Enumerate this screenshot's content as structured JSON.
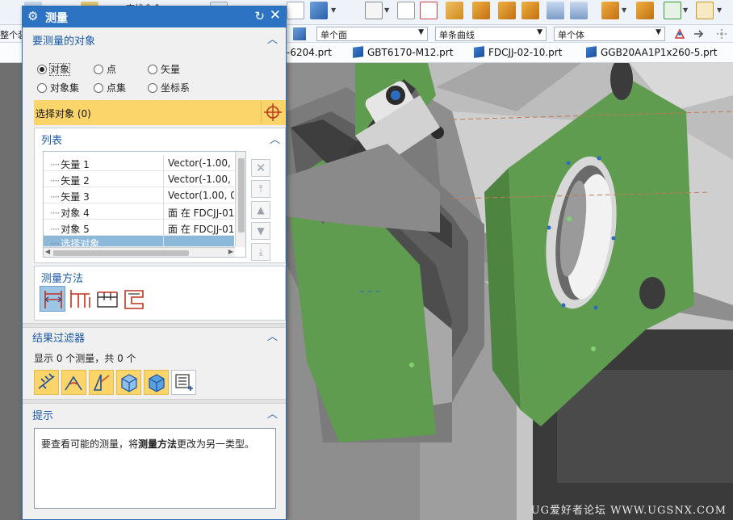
{
  "toolbar": {
    "left_labels": [
      "查找命令"
    ],
    "row2_left_label": "整个装"
  },
  "filterbar": {
    "face_filter": "单个面",
    "curve_filter": "单条曲线",
    "body_filter": "单个体"
  },
  "file_tabs": [
    {
      "label": "-6204.prt"
    },
    {
      "label": "GBT6170-M12.prt"
    },
    {
      "label": "FDCJJ-02-10.prt"
    },
    {
      "label": "GGB20AA1P1x260-5.prt"
    }
  ],
  "dialog": {
    "title": "测量",
    "section_objects": {
      "title": "要测量的对象",
      "radios": [
        {
          "label": "对象",
          "checked": true
        },
        {
          "label": "点",
          "checked": false
        },
        {
          "label": "矢量",
          "checked": false
        },
        {
          "label": "对象集",
          "checked": false
        },
        {
          "label": "点集",
          "checked": false
        },
        {
          "label": "坐标系",
          "checked": false
        }
      ],
      "select_label": "选择对象 (0)"
    },
    "list": {
      "title": "列表",
      "rows": [
        {
          "name": "矢量 1",
          "value": "Vector(-1.00, 0"
        },
        {
          "name": "矢量 2",
          "value": "Vector(-1.00, 0"
        },
        {
          "name": "矢量 3",
          "value": "Vector(1.00, 0"
        },
        {
          "name": "对象 4",
          "value": "面 在 FDCJJ-01"
        },
        {
          "name": "对象 5",
          "value": "面 在 FDCJJ-01"
        },
        {
          "name": "选择对象",
          "value": ""
        }
      ]
    },
    "method": {
      "title": "测量方法"
    },
    "result_filter": {
      "title": "结果过滤器",
      "count_text": "显示 0 个测量，共 0 个"
    },
    "hint": {
      "title": "提示",
      "text_before": "要查看可能的测量，将",
      "text_bold": "测量方法",
      "text_after": "更改为另一类型。"
    }
  },
  "watermark": "UG爱好者论坛 WWW.UGSNX.COM",
  "colors": {
    "title_bar": "#2d73c3",
    "section_text": "#1a5ba8",
    "select_highlight": "#fbd56a",
    "model_green": "#5f9c4f",
    "model_gray": "#9a9a9a"
  }
}
